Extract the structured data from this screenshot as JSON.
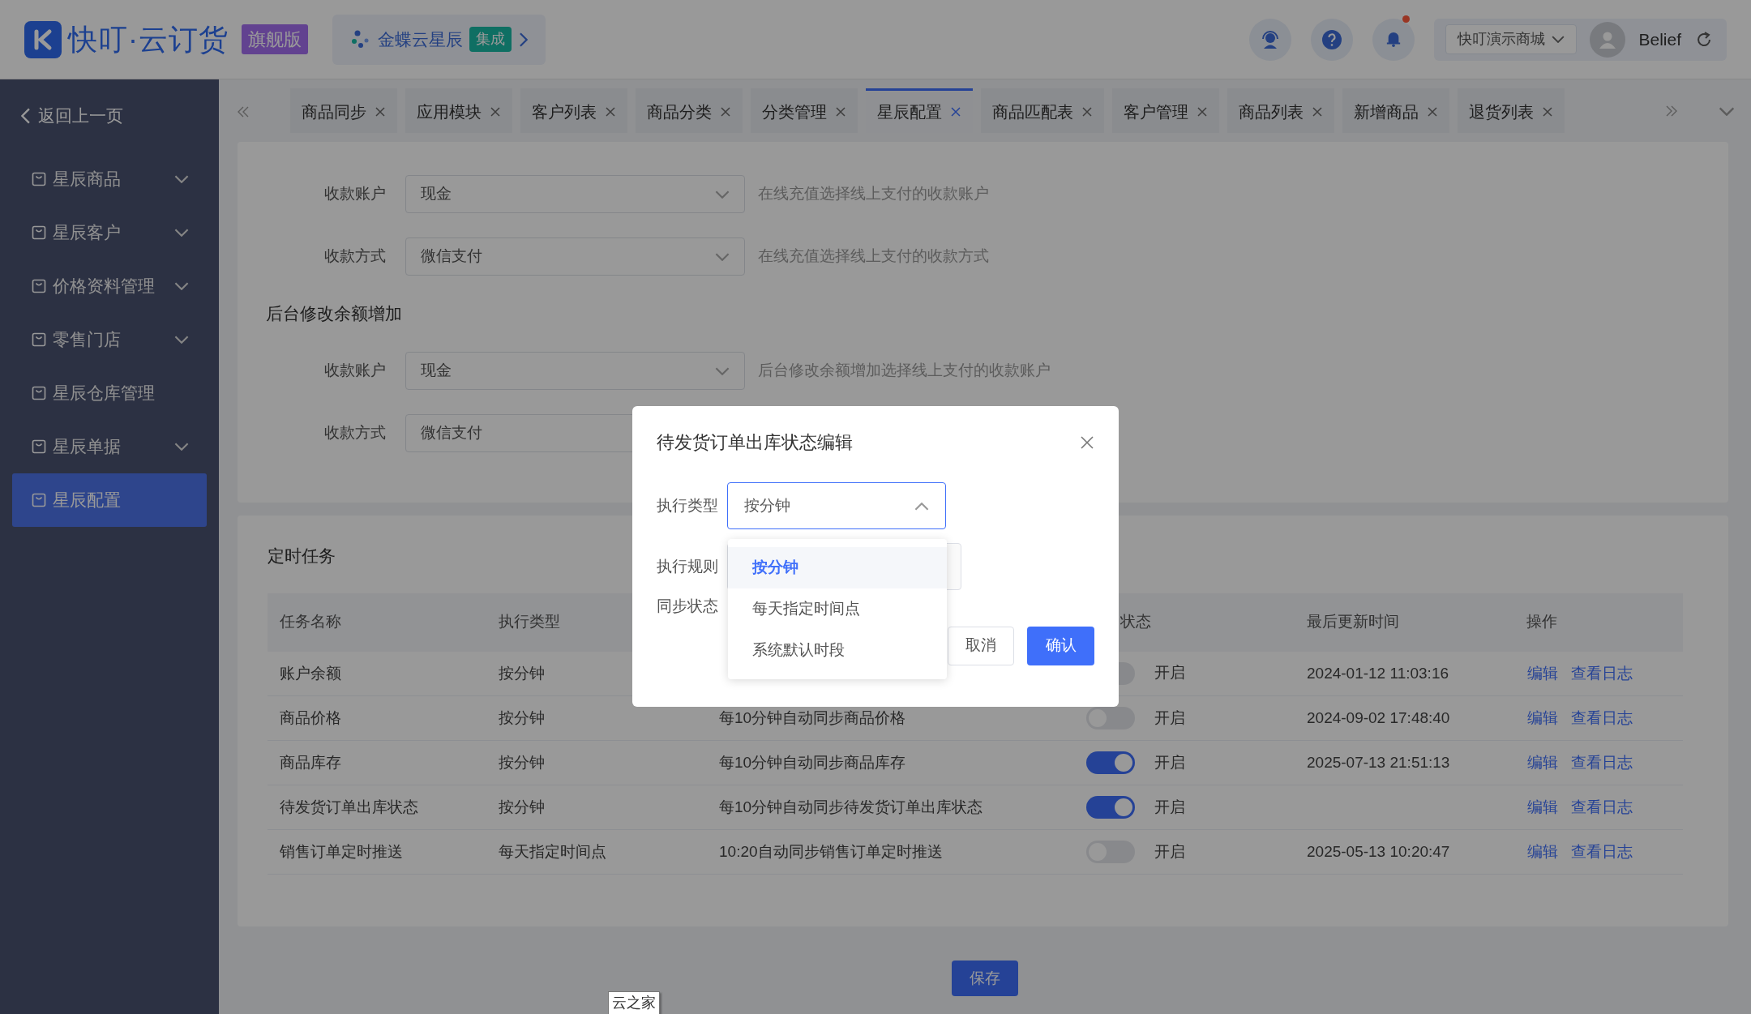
{
  "header": {
    "logo_text": "快叮·云订货",
    "edition_badge": "旗舰版",
    "integration": {
      "name": "金蝶云星辰",
      "badge": "集成"
    },
    "store_selector": "快叮演示商城",
    "user_name": "Belief",
    "has_notification": true
  },
  "sidebar": {
    "back_label": "返回上一页",
    "items": [
      {
        "label": "星辰商品",
        "has_children": true,
        "selected": false
      },
      {
        "label": "星辰客户",
        "has_children": true,
        "selected": false
      },
      {
        "label": "价格资料管理",
        "has_children": true,
        "selected": false
      },
      {
        "label": "零售门店",
        "has_children": true,
        "selected": false
      },
      {
        "label": "星辰仓库管理",
        "has_children": false,
        "selected": false
      },
      {
        "label": "星辰单据",
        "has_children": true,
        "selected": false
      },
      {
        "label": "星辰配置",
        "has_children": false,
        "selected": true
      }
    ]
  },
  "tabs": [
    {
      "label": "商品同步",
      "selected": false
    },
    {
      "label": "应用模块",
      "selected": false
    },
    {
      "label": "客户列表",
      "selected": false
    },
    {
      "label": "商品分类",
      "selected": false
    },
    {
      "label": "分类管理",
      "selected": false
    },
    {
      "label": "星辰配置",
      "selected": true
    },
    {
      "label": "商品匹配表",
      "selected": false
    },
    {
      "label": "客户管理",
      "selected": false
    },
    {
      "label": "商品列表",
      "selected": false
    },
    {
      "label": "新增商品",
      "selected": false
    },
    {
      "label": "退货列表",
      "selected": false
    }
  ],
  "settings": [
    {
      "kind": "field",
      "label": "收款账户",
      "value": "现金",
      "hint": "在线充值选择线上支付的收款账户"
    },
    {
      "kind": "field",
      "label": "收款方式",
      "value": "微信支付",
      "hint": "在线充值选择线上支付的收款方式"
    },
    {
      "kind": "heading",
      "label": "后台修改余额增加"
    },
    {
      "kind": "field",
      "label": "收款账户",
      "value": "现金",
      "hint": "后台修改余额增加选择线上支付的收款账户"
    },
    {
      "kind": "field",
      "label": "收款方式",
      "value": "微信支付"
    }
  ],
  "tasks": {
    "title": "定时任务",
    "columns": [
      "任务名称",
      "执行类型",
      "状态",
      "最后更新时间",
      "操作"
    ],
    "rows": [
      {
        "name": "账户余额",
        "type": "按分钟",
        "on": false,
        "status": "开启",
        "updated": "2024-01-12 11:03:16",
        "actions": [
          "编辑",
          "查看日志"
        ]
      },
      {
        "name": "商品价格",
        "type": "按分钟",
        "rule": "每10分钟自动同步商品价格",
        "on": false,
        "status": "开启",
        "updated": "2024-09-02 17:48:40",
        "actions": [
          "编辑",
          "查看日志"
        ]
      },
      {
        "name": "商品库存",
        "type": "按分钟",
        "rule": "每10分钟自动同步商品库存",
        "on": true,
        "status": "开启",
        "updated": "2025-07-13 21:51:13",
        "actions": [
          "编辑",
          "查看日志"
        ]
      },
      {
        "name": "待发货订单出库状态",
        "type": "按分钟",
        "rule": "每10分钟自动同步待发货订单出库状态",
        "on": true,
        "status": "开启",
        "actions": [
          "编辑",
          "查看日志"
        ]
      },
      {
        "name": "销售订单定时推送",
        "type": "每天指定时间点",
        "rule": "10:20自动同步销售订单定时推送",
        "on": false,
        "status": "开启",
        "updated": "2025-05-13 10:20:47",
        "actions": [
          "编辑",
          "查看日志"
        ]
      }
    ]
  },
  "save_button": "保存",
  "dialog": {
    "title": "待发货订单出库状态编辑",
    "type_label": "执行类型",
    "type_value": "按分钟",
    "expanded": true,
    "rule_label": "执行规则",
    "sync_label": "同步状态",
    "options": [
      {
        "label": "按分钟",
        "selected": true
      },
      {
        "label": "每天指定时间点",
        "selected": false
      },
      {
        "label": "系统默认时段",
        "selected": false
      }
    ],
    "cancel": "取消",
    "confirm": "确认"
  },
  "tooltip": "云之家"
}
